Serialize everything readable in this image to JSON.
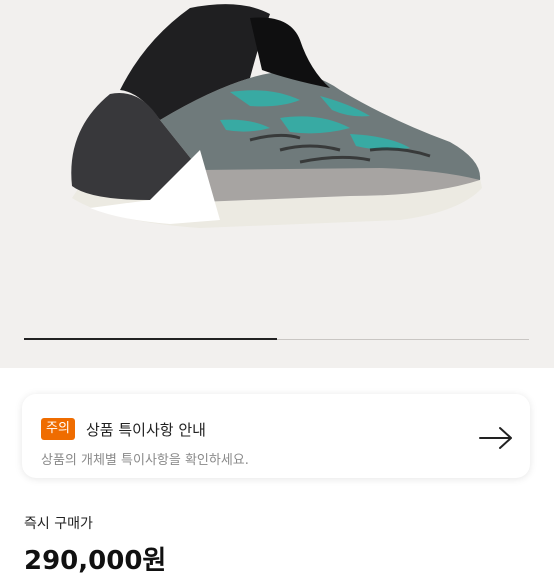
{
  "notice": {
    "badge": "주의",
    "title": "상품 특이사항 안내",
    "description": "상품의 개체별 특이사항을 확인하세요."
  },
  "purchase": {
    "label": "즉시 구매가",
    "price": "290,000원"
  },
  "gallery": {
    "progress": 0.5
  }
}
